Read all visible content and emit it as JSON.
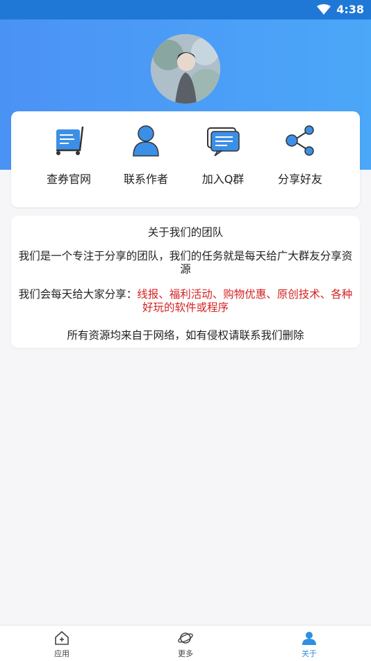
{
  "status": {
    "time": "4:38"
  },
  "actions": [
    {
      "label": "查券官网",
      "icon": "cart-icon"
    },
    {
      "label": "联系作者",
      "icon": "person-icon"
    },
    {
      "label": "加入Q群",
      "icon": "chat-icon"
    },
    {
      "label": "分享好友",
      "icon": "share-icon"
    }
  ],
  "about": {
    "title": "关于我们的团队",
    "p1": "我们是一个专注于分享的团队，我们的任务就是每天给广大群友分享资源",
    "p2_prefix": "我们会每天给大家分享：",
    "p2_highlight": "线报、福利活动、购物优惠、原创技术、各种好玩的软件或程序",
    "p3": "所有资源均来自于网络，如有侵权请联系我们删除"
  },
  "tabs": [
    {
      "label": "应用",
      "icon": "home-icon"
    },
    {
      "label": "更多",
      "icon": "planet-icon"
    },
    {
      "label": "关于",
      "icon": "profile-icon",
      "active": true
    }
  ],
  "colors": {
    "accent": "#2f8fe0",
    "header": "#4b9ef6",
    "highlight": "#d42222"
  }
}
